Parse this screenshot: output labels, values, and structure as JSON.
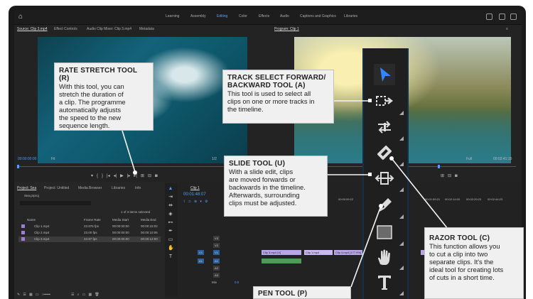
{
  "topbar": {
    "workspaces": [
      "Learning",
      "Assembly",
      "Editing",
      "Color",
      "Effects",
      "Audio",
      "Captions and Graphics",
      "Libraries"
    ],
    "active": "Editing"
  },
  "source": {
    "tabs": [
      "Source: Clip 3.mp4",
      "Effect Controls",
      "Audio Clip Mixer: Clip 3.mp4",
      "Metadata"
    ],
    "timecode": "00:00:00:00",
    "fit": "Fit"
  },
  "program": {
    "tab": "Program: Clip 1",
    "fraction": "1/2",
    "full": "Full",
    "timecode": "00:02:41:15"
  },
  "project": {
    "tabs": [
      "Project: Sea",
      "Project: Untitled",
      "Media Browser",
      "Libraries",
      "Info"
    ],
    "file": "Sea.prproj",
    "items_selected": "1 of 3 items selected",
    "columns": [
      "Name",
      "Frame Rate",
      "Media Start",
      "Media End"
    ],
    "rows": [
      {
        "name": "Clip 1.mp4",
        "fps": "23.976 fps",
        "start": "00:00:00:00",
        "end": "00:00:15:02"
      },
      {
        "name": "Clip 2.mp4",
        "fps": "23.00 fps",
        "start": "00:00:00:00",
        "end": "00:00:10:06"
      },
      {
        "name": "Clip 3.mp4",
        "fps": "23.97 fps",
        "start": "00:00:00:00",
        "end": "00:00:12:00"
      }
    ]
  },
  "timeline": {
    "tab": "Clip 1",
    "timecode": "00:01:48:07",
    "ruler": [
      "00:00:59:22",
      "00:01:59:21",
      "00:02:14:00",
      "00:02:29:23",
      "00:02:44:23"
    ],
    "tracks": [
      "V3",
      "V2",
      "V1",
      "A1",
      "A2",
      "A3"
    ],
    "master": "Mix",
    "master_value": "0.0",
    "clips": [
      "Clip 3.mp4 [V]",
      "Clip 1.mp4",
      "Clip 4.mp4 [177.9%]"
    ]
  },
  "callouts": {
    "rate_stretch": {
      "title": "RATE STRETCH TOOL (R)",
      "lines": [
        "With this tool, you can",
        "stretch the duration of",
        "a clip. The programme",
        "automatically adjusts",
        "the speed to the new",
        "sequence length."
      ]
    },
    "track_select": {
      "title": [
        "TRACK SELECT FORWARD/",
        "BACKWARD TOOL (A)"
      ],
      "lines": [
        "This tool is used to select all",
        "clips on one or more tracks in",
        "the timeline."
      ]
    },
    "slide": {
      "title": "SLIDE TOOL (U)",
      "lines": [
        "With a slide edit, clips",
        "are moved forwards or",
        "backwards in the timeline.",
        "Afterwards, surrounding",
        "clips must be adjusted."
      ]
    },
    "razor": {
      "title": "RAZOR TOOL (C)",
      "lines": [
        "This function allows you",
        "to cut a clip into two",
        "separate clips. It's the",
        "ideal tool for creating lots",
        "of cuts in a short time."
      ]
    },
    "pen": {
      "title": "PEN TOOL (P)"
    }
  },
  "icons": {
    "tools": [
      "selection-tool-icon",
      "track-select-forward-icon",
      "ripple-edit-icon",
      "razor-icon",
      "slip-icon",
      "pen-icon",
      "rectangle-icon",
      "hand-icon",
      "type-icon"
    ]
  }
}
